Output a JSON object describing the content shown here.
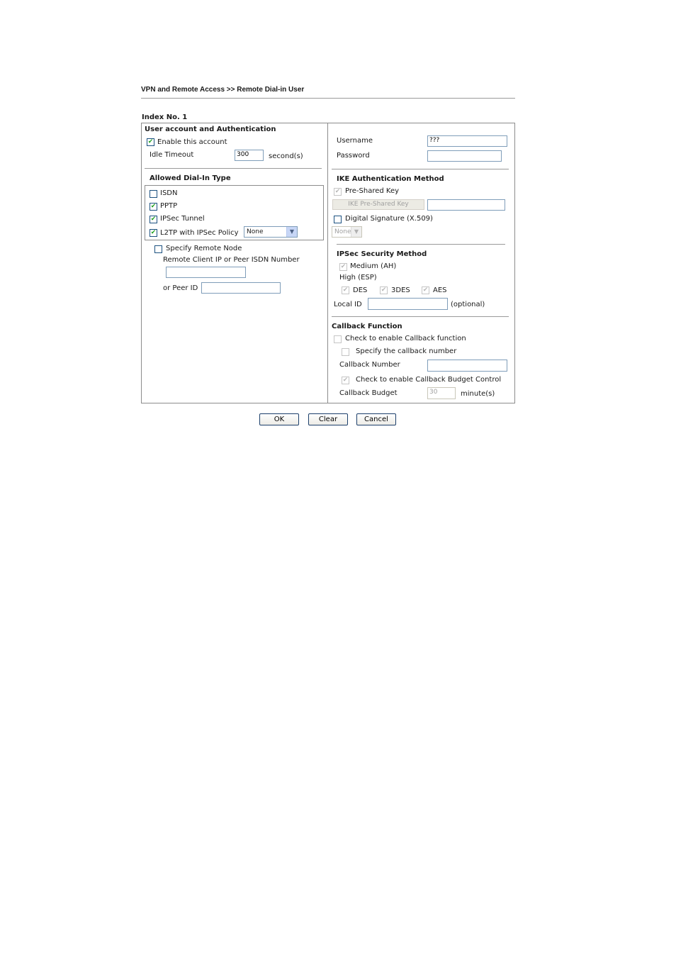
{
  "breadcrumb": "VPN and Remote Access >> Remote Dial-in User",
  "index_label": "Index No. 1",
  "left": {
    "section_title": "User account and Authentication",
    "enable_account": {
      "label": "Enable this account",
      "checked": true
    },
    "idle_timeout": {
      "label": "Idle Timeout",
      "value": "300",
      "unit": "second(s)"
    },
    "dialin": {
      "title": "Allowed Dial-In Type",
      "isdn": {
        "label": "ISDN",
        "checked": false
      },
      "pptp": {
        "label": "PPTP",
        "checked": true
      },
      "ipsec_tunnel": {
        "label": "IPSec Tunnel",
        "checked": true
      },
      "l2tp": {
        "label": "L2TP with IPSec Policy",
        "checked": true,
        "policy": "None"
      }
    },
    "remote_node": {
      "label": "Specify Remote Node",
      "checked": false,
      "remote_ip_label": "Remote Client IP or Peer ISDN Number",
      "remote_ip_value": "",
      "peer_id_label": "or Peer ID",
      "peer_id_value": ""
    }
  },
  "right": {
    "username": {
      "label": "Username",
      "value": "???"
    },
    "password": {
      "label": "Password",
      "value": ""
    },
    "ike": {
      "title": "IKE Authentication Method",
      "pre_shared": {
        "label": "Pre-Shared Key",
        "checked": true
      },
      "key_button": "IKE Pre-Shared Key",
      "key_value": "",
      "digital_sig": {
        "label": "Digital Signature (X.509)",
        "checked": false
      },
      "cert_select": "None"
    },
    "ipsec": {
      "title": "IPSec Security Method",
      "medium": {
        "label": "Medium (AH)",
        "checked": true
      },
      "high_label": "High (ESP)",
      "des": {
        "label": "DES",
        "checked": true
      },
      "3des": {
        "label": "3DES",
        "checked": true
      },
      "aes": {
        "label": "AES",
        "checked": true
      },
      "local_id_label": "Local ID",
      "local_id_value": "",
      "local_id_hint": "(optional)"
    },
    "callback": {
      "title": "Callback Function",
      "enable": {
        "label": "Check to enable Callback function",
        "checked": false
      },
      "specify_number": {
        "label": "Specify the callback number",
        "checked": false
      },
      "number_label": "Callback Number",
      "number_value": "",
      "budget_control": {
        "label": "Check to enable Callback Budget Control",
        "checked": true
      },
      "budget_label": "Callback Budget",
      "budget_value": "30",
      "budget_unit": "minute(s)"
    }
  },
  "buttons": {
    "ok": "OK",
    "clear": "Clear",
    "cancel": "Cancel"
  },
  "colors": {
    "check_enabled": "#21a121",
    "check_disabled": "#b8b8b8",
    "input_border": "#7f9db9"
  }
}
